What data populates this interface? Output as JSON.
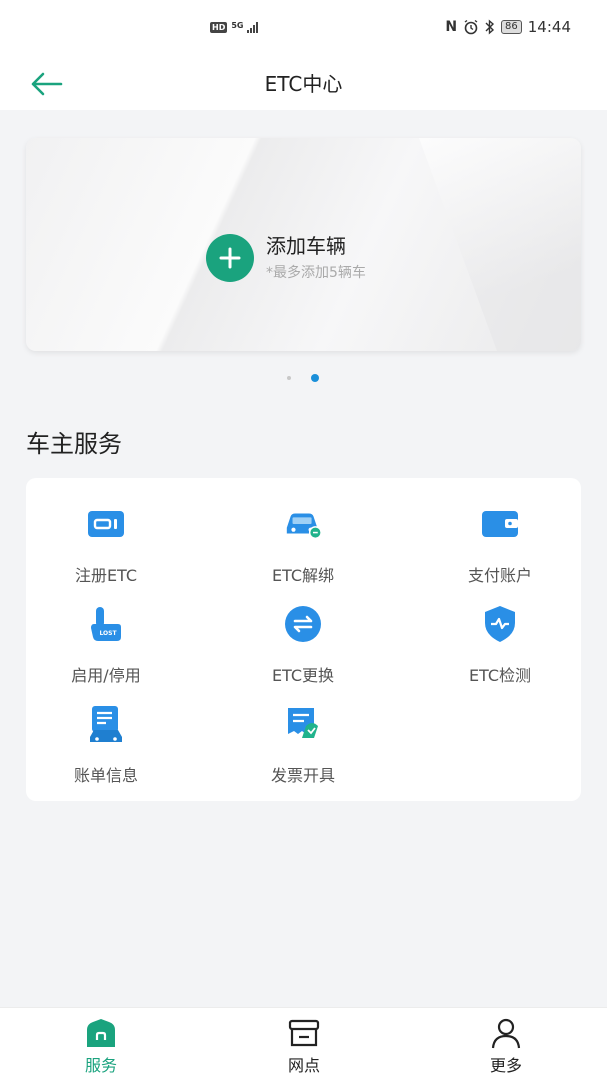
{
  "status_bar": {
    "hd": "HD",
    "network": "5G",
    "battery": "86",
    "time": "14:44"
  },
  "nav": {
    "title": "ETC中心",
    "accent_color": "#1aa37e"
  },
  "vehicle_card": {
    "add_label": "添加车辆",
    "add_hint": "*最多添加5辆车"
  },
  "pager": {
    "count": 2,
    "active_index": 1
  },
  "services": {
    "section_title": "车主服务",
    "items": [
      {
        "label": "注册ETC",
        "icon": "etc-card-icon"
      },
      {
        "label": "ETC解绑",
        "icon": "car-unbind-icon"
      },
      {
        "label": "支付账户",
        "icon": "wallet-icon"
      },
      {
        "label": "启用/停用",
        "icon": "hand-lost-icon"
      },
      {
        "label": "ETC更换",
        "icon": "exchange-icon"
      },
      {
        "label": "ETC检测",
        "icon": "shield-check-icon"
      },
      {
        "label": "账单信息",
        "icon": "bill-car-icon"
      },
      {
        "label": "发票开具",
        "icon": "invoice-icon"
      }
    ]
  },
  "tabs": [
    {
      "label": "服务",
      "icon": "home-icon",
      "active": true
    },
    {
      "label": "网点",
      "icon": "store-icon",
      "active": false
    },
    {
      "label": "更多",
      "icon": "user-icon",
      "active": false
    }
  ]
}
